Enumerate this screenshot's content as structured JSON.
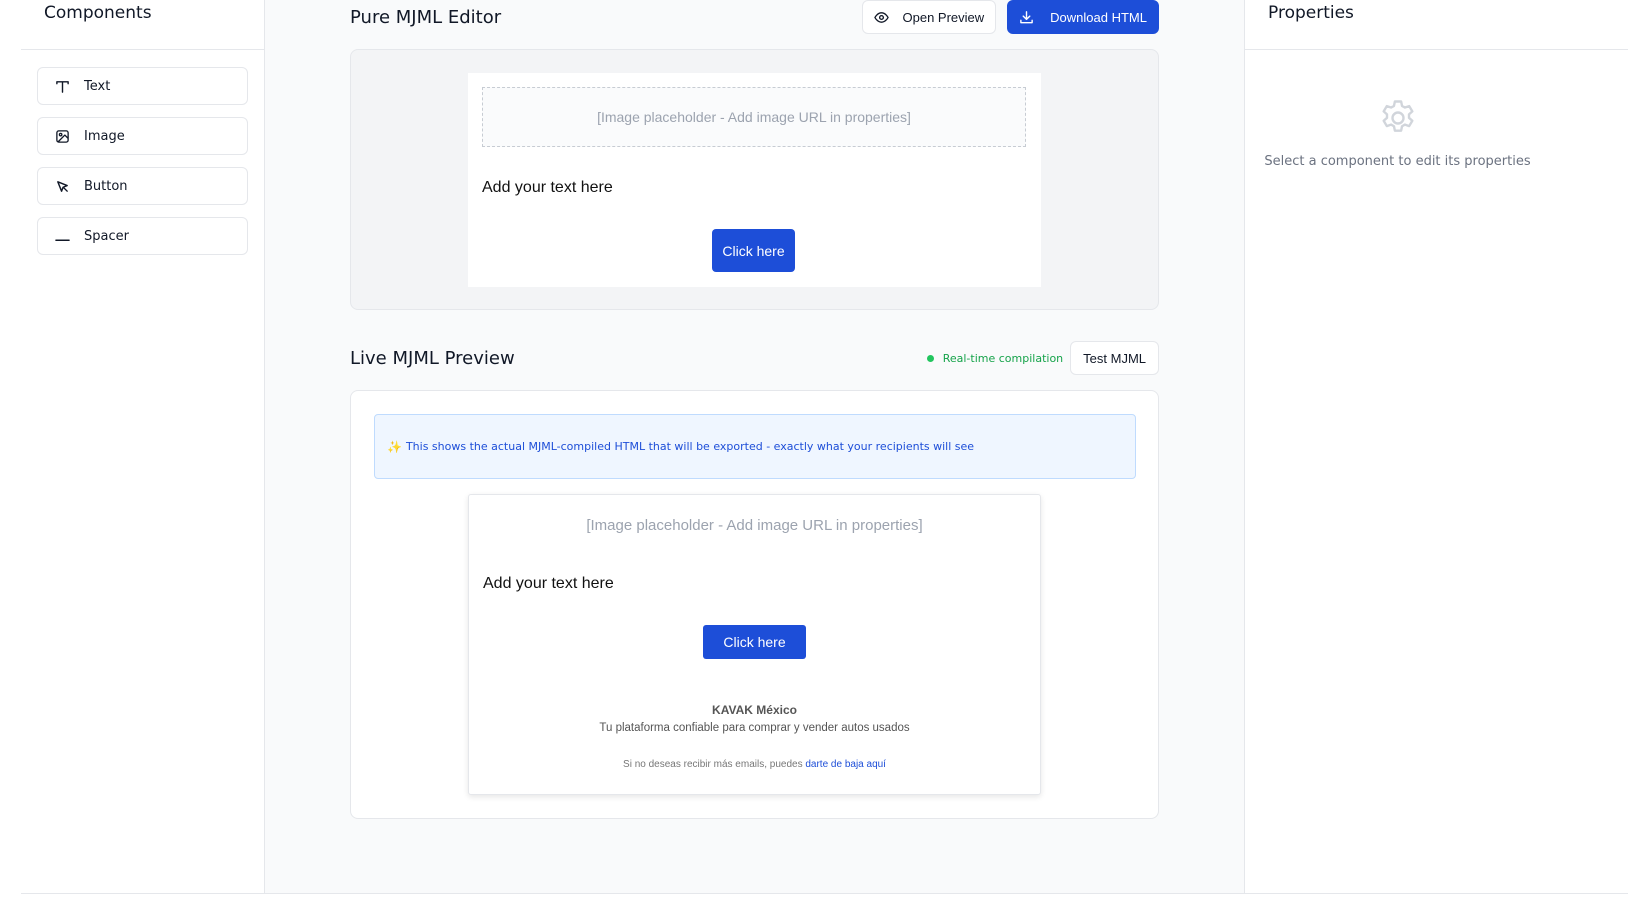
{
  "sidebar": {
    "title": "Components",
    "items": [
      {
        "label": "Text",
        "icon": "text-icon"
      },
      {
        "label": "Image",
        "icon": "image-icon"
      },
      {
        "label": "Button",
        "icon": "pointer-icon"
      },
      {
        "label": "Spacer",
        "icon": "spacer-icon"
      }
    ]
  },
  "editor": {
    "title": "Pure MJML Editor",
    "open_preview_label": "Open Preview",
    "download_label": "Download HTML",
    "canvas": {
      "image_placeholder": "[Image placeholder - Add image URL in properties]",
      "text": "Add your text here",
      "button_label": "Click here"
    }
  },
  "preview": {
    "title": "Live MJML Preview",
    "status": "Real-time compilation",
    "test_label": "Test MJML",
    "info": "This shows the actual MJML-compiled HTML that will be exported - exactly what your recipients will see",
    "email": {
      "image_placeholder": "[Image placeholder - Add image URL in properties]",
      "text": "Add your text here",
      "button_label": "Click here",
      "company": "KAVAK México",
      "tagline": "Tu plataforma confiable para comprar y vender autos usados",
      "unsubscribe_prefix": "Si no deseas recibir más emails, puedes",
      "unsubscribe_link": "darte de baja aquí"
    }
  },
  "properties": {
    "title": "Properties",
    "empty_message": "Select a component to edit its properties"
  },
  "colors": {
    "primary": "#1d4ed8",
    "status_green": "#16a34a",
    "info_bg": "#eff6ff"
  }
}
